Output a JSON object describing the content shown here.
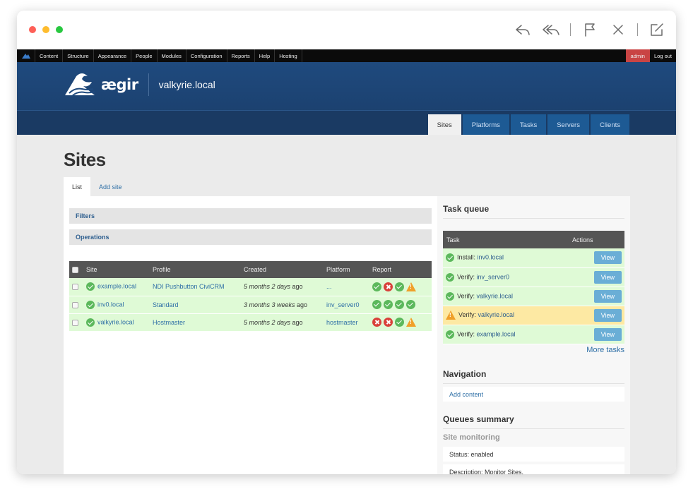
{
  "window": {
    "dots": [
      "close",
      "minimize",
      "zoom"
    ],
    "toolbar_icons": [
      "reply-icon",
      "reply-all-icon",
      "flag-icon",
      "close-icon",
      "compose-icon"
    ]
  },
  "adminbar": {
    "menu": [
      "Content",
      "Structure",
      "Appearance",
      "People",
      "Modules",
      "Configuration",
      "Reports",
      "Help",
      "Hosting"
    ],
    "user": "admin",
    "logout": "Log out"
  },
  "header": {
    "logo_text": "ægir",
    "site_name": "valkyrie.local",
    "tabs": [
      "Sites",
      "Platforms",
      "Tasks",
      "Servers",
      "Clients"
    ],
    "active_tab": "Sites"
  },
  "page": {
    "title": "Sites",
    "subtabs": [
      "List",
      "Add site"
    ],
    "filters_label": "Filters",
    "operations_label": "Operations"
  },
  "sites_table": {
    "headers": [
      "Site",
      "Profile",
      "Created",
      "Platform",
      "Report"
    ],
    "rows": [
      {
        "site": "example.local",
        "profile": "NDI Pushbutton CiviCRM",
        "created_em": "5 months 2 days",
        "created_suffix": " ago",
        "platform": "...",
        "report": [
          "ok",
          "err",
          "ok",
          "warn"
        ]
      },
      {
        "site": "inv0.local",
        "profile": "Standard",
        "created_em": "3 months 3 weeks",
        "created_suffix": " ago",
        "platform": "inv_server0",
        "report": [
          "ok",
          "ok",
          "ok",
          "ok"
        ]
      },
      {
        "site": "valkyrie.local",
        "profile": "Hostmaster",
        "created_em": "5 months 2 days",
        "created_suffix": " ago",
        "platform": "hostmaster",
        "report": [
          "err",
          "err",
          "ok",
          "warn"
        ]
      }
    ]
  },
  "task_queue": {
    "heading": "Task queue",
    "headers": [
      "Task",
      "Actions"
    ],
    "rows": [
      {
        "status": "ok",
        "label": "Install: ",
        "target": "inv0.local",
        "action": "View"
      },
      {
        "status": "ok",
        "label": "Verify: ",
        "target": "inv_server0",
        "action": "View"
      },
      {
        "status": "ok",
        "label": "Verify: ",
        "target": "valkyrie.local",
        "action": "View"
      },
      {
        "status": "warn",
        "label": "Verify: ",
        "target": "valkyrie.local",
        "action": "View"
      },
      {
        "status": "ok",
        "label": "Verify: ",
        "target": "example.local",
        "action": "View"
      }
    ],
    "more": "More tasks"
  },
  "navigation": {
    "heading": "Navigation",
    "links": [
      "Add content"
    ]
  },
  "queues_summary": {
    "heading": "Queues summary",
    "sub": "Site monitoring",
    "items": [
      "Status: enabled",
      "Description: Monitor Sites."
    ]
  },
  "colors": {
    "header_blue": "#1f4a7e",
    "tab_blue": "#1d5a94",
    "row_green": "#dffad6",
    "row_warning": "#fde9a3",
    "admin_red": "#c94444",
    "link": "#2e6fa6"
  }
}
